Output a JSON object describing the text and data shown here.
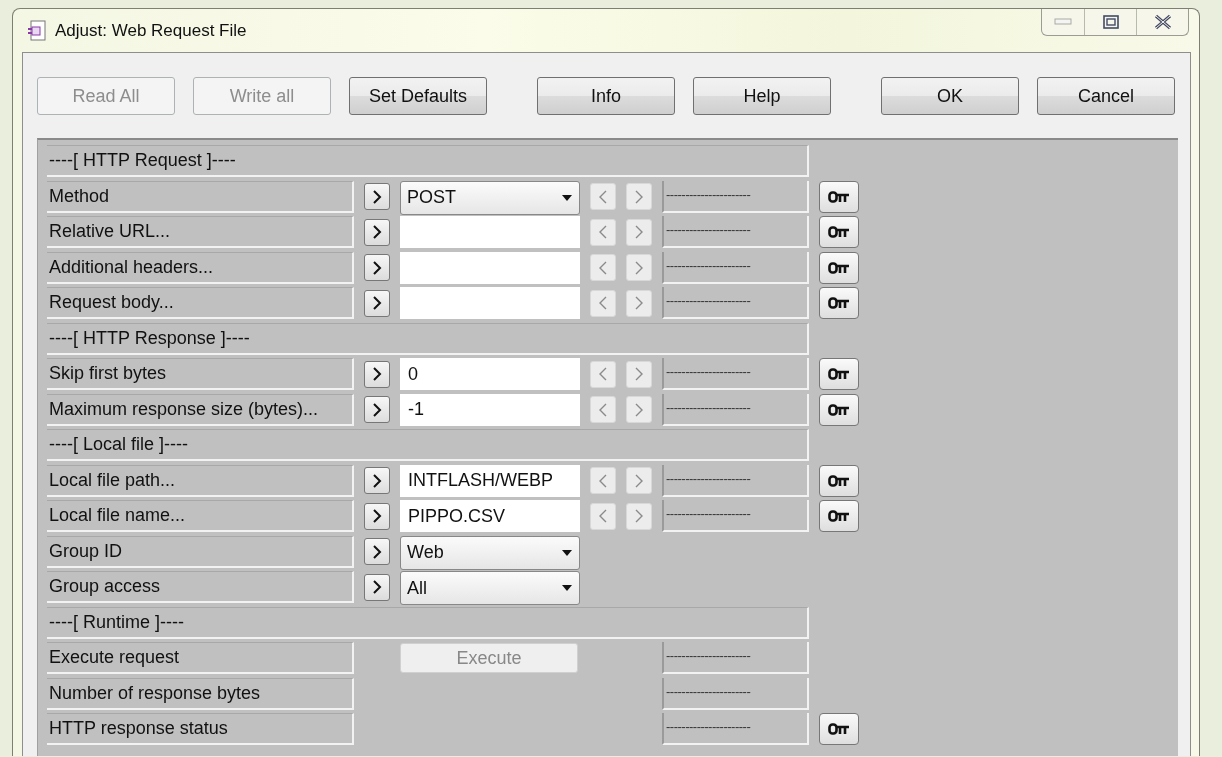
{
  "window": {
    "title": "Adjust: Web Request File"
  },
  "toolbar": [
    [
      {
        "label": "Read All",
        "disabled": true
      },
      {
        "label": "Write all",
        "disabled": true
      },
      {
        "label": "Set Defaults",
        "disabled": false
      }
    ],
    [
      {
        "label": "Info",
        "disabled": false
      },
      {
        "label": "Help",
        "disabled": false
      }
    ],
    [
      {
        "label": "OK",
        "disabled": false
      },
      {
        "label": "Cancel",
        "disabled": false
      }
    ]
  ],
  "rows": [
    {
      "kind": "section",
      "label": "----[ HTTP Request ]----"
    },
    {
      "kind": "param",
      "label": "Method",
      "set": true,
      "control": {
        "kind": "select",
        "value": "POST"
      },
      "nav": true,
      "readout": "----------------------",
      "key": true
    },
    {
      "kind": "param",
      "label": "Relative URL...",
      "set": true,
      "control": {
        "kind": "input"
      },
      "nav": true,
      "readout": "----------------------",
      "key": true
    },
    {
      "kind": "param",
      "label": "Additional headers...",
      "set": true,
      "control": {
        "kind": "input"
      },
      "nav": true,
      "readout": "----------------------",
      "key": true
    },
    {
      "kind": "param",
      "label": "Request body...",
      "set": true,
      "control": {
        "kind": "input"
      },
      "nav": true,
      "readout": "----------------------",
      "key": true
    },
    {
      "kind": "section",
      "label": "----[ HTTP Response ]----"
    },
    {
      "kind": "param",
      "label": "Skip first bytes",
      "set": true,
      "control": {
        "kind": "input",
        "value": "0"
      },
      "nav": true,
      "readout": "----------------------",
      "key": true
    },
    {
      "kind": "param",
      "label": "Maximum response size (bytes)...",
      "set": true,
      "control": {
        "kind": "input",
        "value": "-1"
      },
      "nav": true,
      "readout": "----------------------",
      "key": true
    },
    {
      "kind": "section",
      "label": "----[ Local file ]----"
    },
    {
      "kind": "param",
      "label": "Local file path...",
      "set": true,
      "control": {
        "kind": "input",
        "value": "INTFLASH/WEBP"
      },
      "nav": true,
      "readout": "----------------------",
      "key": true
    },
    {
      "kind": "param",
      "label": "Local file name...",
      "set": true,
      "control": {
        "kind": "input",
        "value": "PIPPO.CSV"
      },
      "nav": true,
      "readout": "----------------------",
      "key": true
    },
    {
      "kind": "param",
      "label": "Group ID",
      "set": true,
      "control": {
        "kind": "select",
        "value": "Web"
      },
      "nav": false,
      "key": false
    },
    {
      "kind": "param",
      "label": "Group access",
      "set": true,
      "control": {
        "kind": "select",
        "value": "All"
      },
      "nav": false,
      "key": false
    },
    {
      "kind": "section",
      "label": "----[ Runtime ]----"
    },
    {
      "kind": "param",
      "label": "Execute request",
      "set": false,
      "control": {
        "kind": "button",
        "value": "Execute",
        "disabled": true
      },
      "nav": false,
      "readout": "----------------------",
      "key": false
    },
    {
      "kind": "param",
      "label": "Number of response bytes",
      "set": false,
      "nav": false,
      "readout": "----------------------",
      "key": false
    },
    {
      "kind": "param",
      "label": "HTTP response status",
      "set": false,
      "nav": false,
      "readout": "----------------------",
      "key": true
    }
  ]
}
